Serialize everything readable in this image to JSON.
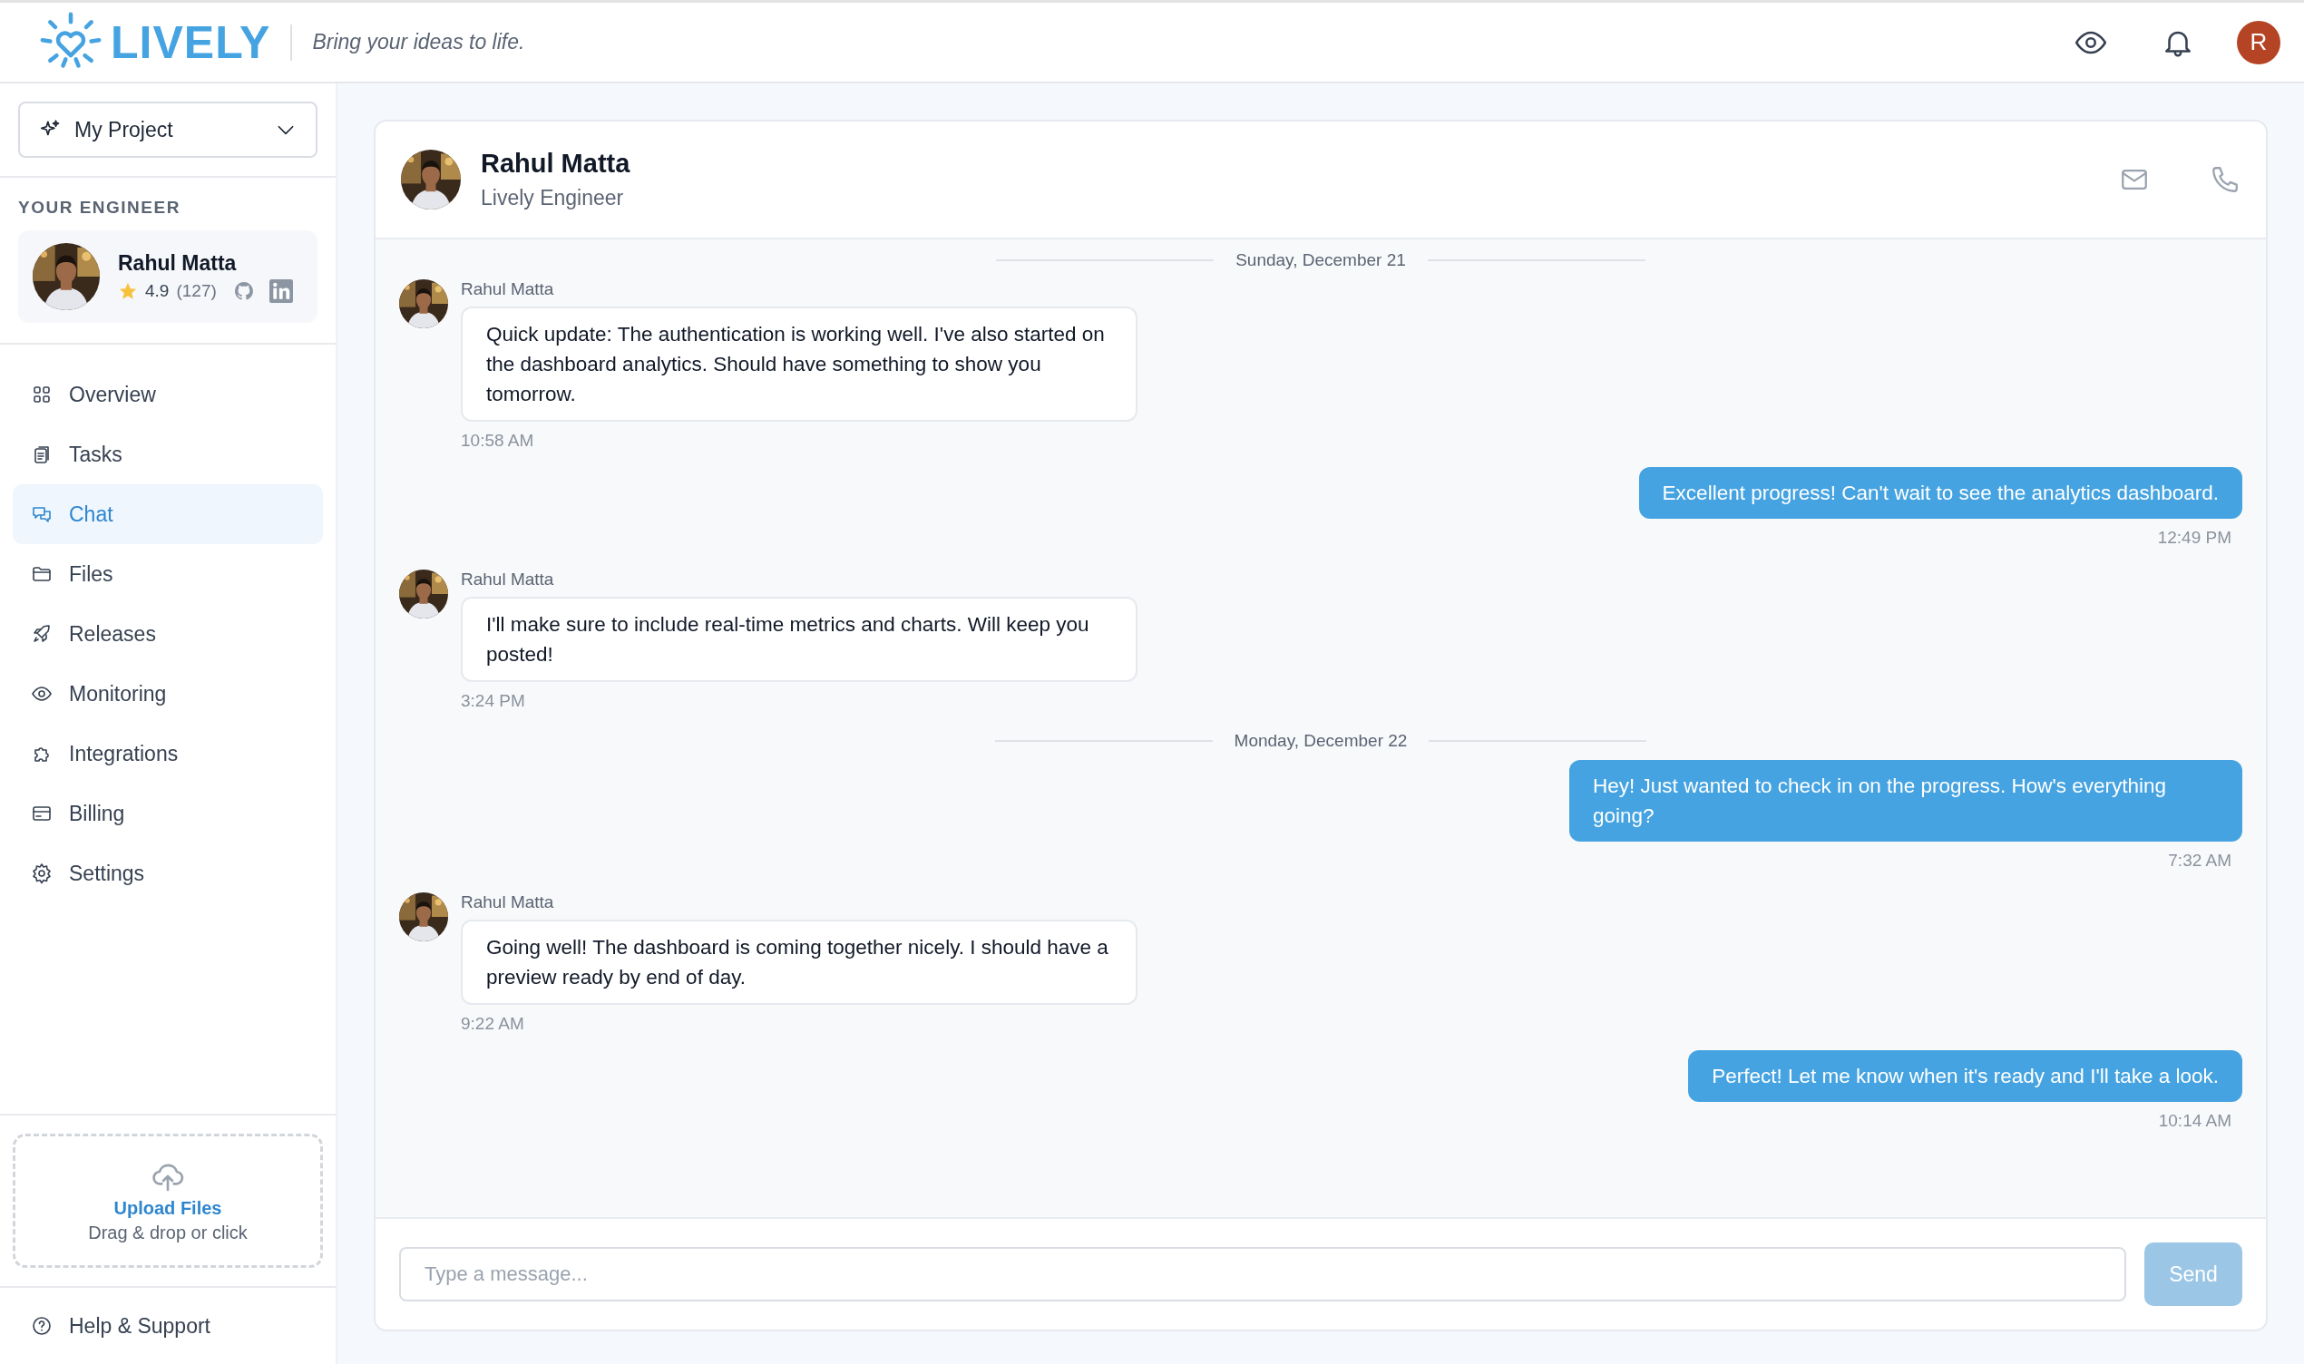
{
  "header": {
    "logo": "LIVELY",
    "tagline": "Bring your ideas to life.",
    "user_initial": "R"
  },
  "sidebar": {
    "project": "My Project",
    "section_label": "YOUR ENGINEER",
    "engineer": {
      "name": "Rahul Matta",
      "rating": "4.9",
      "reviews": "(127)"
    },
    "items": [
      {
        "label": "Overview",
        "selected": false
      },
      {
        "label": "Tasks",
        "selected": false
      },
      {
        "label": "Chat",
        "selected": true
      },
      {
        "label": "Files",
        "selected": false
      },
      {
        "label": "Releases",
        "selected": false
      },
      {
        "label": "Monitoring",
        "selected": false
      },
      {
        "label": "Integrations",
        "selected": false
      },
      {
        "label": "Billing",
        "selected": false
      },
      {
        "label": "Settings",
        "selected": false
      }
    ],
    "upload": {
      "title": "Upload Files",
      "hint": "Drag & drop or click"
    },
    "help": "Help & Support"
  },
  "chat": {
    "name": "Rahul Matta",
    "role": "Lively Engineer",
    "messages": [
      {
        "kind": "date",
        "text": "Sunday, December 21"
      },
      {
        "kind": "incoming",
        "sender": "Rahul Matta",
        "text": "Quick update: The authentication is working well. I've also started on the dashboard analytics. Should have something to show you tomorrow.",
        "time": "10:58 AM"
      },
      {
        "kind": "outgoing",
        "text": "Excellent progress! Can't wait to see the analytics dashboard.",
        "time": "12:49 PM"
      },
      {
        "kind": "incoming",
        "sender": "Rahul Matta",
        "text": "I'll make sure to include real-time metrics and charts. Will keep you posted!",
        "time": "3:24 PM"
      },
      {
        "kind": "date",
        "text": "Monday, December 22"
      },
      {
        "kind": "outgoing",
        "text": "Hey! Just wanted to check in on the progress. How's everything going?",
        "time": "7:32 AM"
      },
      {
        "kind": "incoming",
        "sender": "Rahul Matta",
        "text": "Going well! The dashboard is coming together nicely. I should have a preview ready by end of day.",
        "time": "9:22 AM"
      },
      {
        "kind": "outgoing",
        "text": "Perfect! Let me know when it's ready and I'll take a look.",
        "time": "10:14 AM"
      }
    ],
    "composer": {
      "placeholder": "Type a message...",
      "send": "Send",
      "disabled": true
    }
  }
}
